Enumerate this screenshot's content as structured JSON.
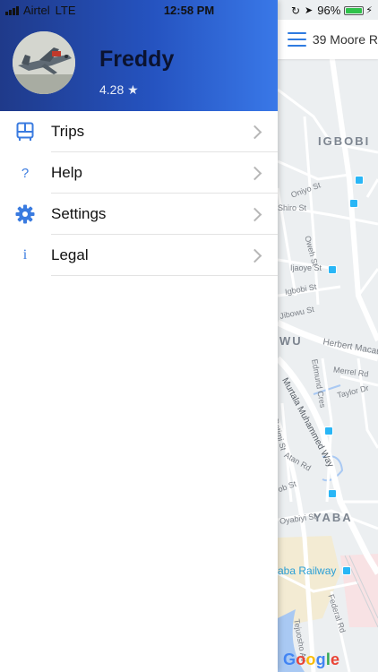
{
  "status_bar": {
    "carrier": "Airtel",
    "network": "LTE",
    "time": "12:58 PM",
    "battery_percent": "96%",
    "battery_level": 0.96
  },
  "profile": {
    "name": "Freddy",
    "rating": "4.28 ★"
  },
  "menu": [
    {
      "label": "Trips",
      "icon": "bus-icon"
    },
    {
      "label": "Help",
      "icon": "question-icon"
    },
    {
      "label": "Settings",
      "icon": "gear-icon"
    },
    {
      "label": "Legal",
      "icon": "info-icon"
    }
  ],
  "map": {
    "address": "39 Moore R",
    "areas": {
      "igbobi": "IGBOBI",
      "wu": "WU",
      "yaba": "YABA"
    },
    "streets": {
      "oniyo": "Oniyo St",
      "shiro": "Shiro St",
      "oweh": "Oweh St",
      "ijaoye": "Ijaoye St",
      "igbobi": "Igbobi St",
      "jibowu": "Jibowu St",
      "herbert": "Herbert Macau",
      "merrel": "Merrel Rd",
      "edmund": "Edmund Cres",
      "taylor": "Taylor Dr",
      "murtala": "Murtala Muhammed Way",
      "rotimi": "Rotimi St",
      "atan": "Atan Rd",
      "ob": "ob St",
      "oyabiyi": "Oyabiyi St",
      "railway": "aba Railway",
      "federal": "Federal Rd",
      "tejuosho": "Tejuosho Av"
    },
    "google_letters": [
      "G",
      "o",
      "o",
      "g",
      "l",
      "e"
    ],
    "colors": {
      "road": "#ffffff",
      "land": "#eceff1",
      "water": "#a9c9f3",
      "park": "#f3ebd3",
      "accent": "#2f7be0"
    }
  }
}
